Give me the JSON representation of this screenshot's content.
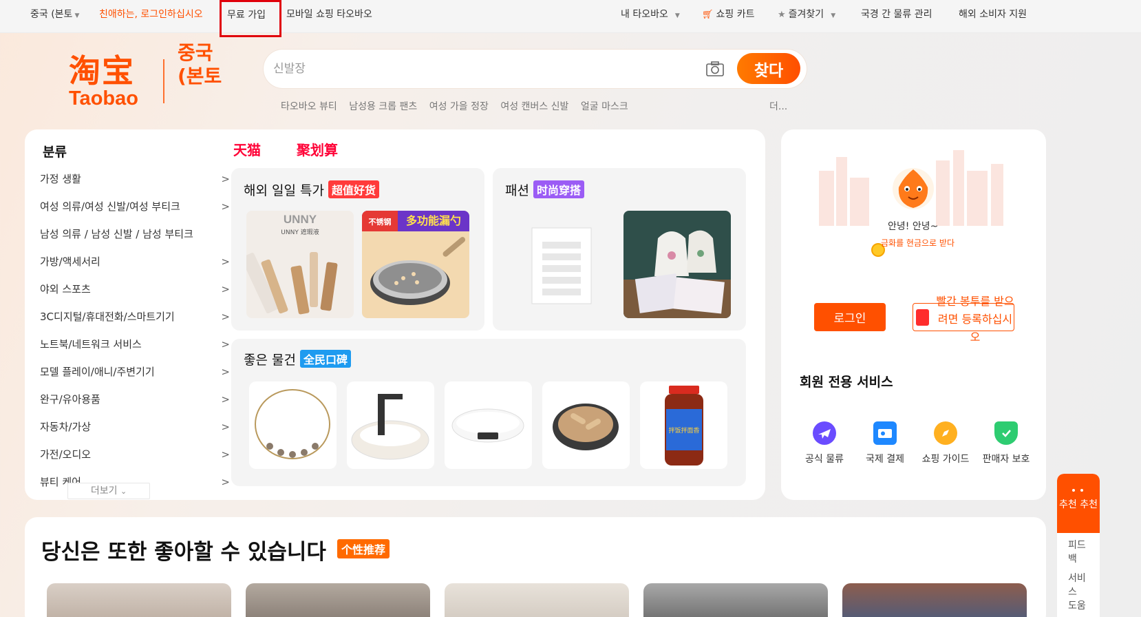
{
  "topbar": {
    "region": "중국 (본토",
    "login_prompt": "친애하는, 로그인하십시오",
    "signup": "무료 가입",
    "mobile": "모바일 쇼핑 타오바오",
    "my_taobao": "내 타오바오",
    "cart": "쇼핑 카트",
    "favorites": "즐겨찾기",
    "logistics": "국경 간 물류 관리",
    "support": "해외 소비자 지원"
  },
  "logo": {
    "cn": "淘宝",
    "en": "Taobao"
  },
  "region_label": "중국 (본토",
  "search": {
    "placeholder": "신발장",
    "button": "찾다"
  },
  "hotwords": [
    "타오바오 뷰티",
    "남성용 크롭 팬츠",
    "여성 가을 정장",
    "여성 캔버스 신발",
    "얼굴 마스크"
  ],
  "hotwords_more": "더...",
  "categories": {
    "title": "분류",
    "items": [
      "가정 생활",
      "여성 의류/여성 신발/여성 부티크",
      "남성 의류 / 남성 신발 / 남성 부티크",
      "가방/액세서리",
      "야외 스포츠",
      "3C디지털/휴대전화/스마트기기",
      "노트북/네트워크 서비스",
      "모델 플레이/애니/주변기기",
      "완구/유아용품",
      "자동차/가상",
      "가전/오디오",
      "뷰티 케어"
    ],
    "more": "더보기"
  },
  "brands": {
    "tmall": "天猫",
    "juhuasuan": "聚划算"
  },
  "panels": {
    "deals": {
      "title": "해외 일일 특가",
      "tag": "超值好货",
      "tag_color": "#ff3b3b"
    },
    "fashion": {
      "title": "패션",
      "tag": "时尚穿搭",
      "tag_color": "#9b5cf5"
    },
    "goods": {
      "title": "좋은 물건",
      "tag": "全民口碑",
      "tag_color": "#1e9bf0"
    }
  },
  "product_text": {
    "unny_brand": "UNNY",
    "unny_sub": "UNNY 遮瑕液",
    "pan_badge": "不锈钢",
    "pan_title": "多功能漏勺",
    "jar_label": "拌饭拌面香"
  },
  "user": {
    "hello": "안녕! 안녕~",
    "coins": "금화를 현금으로 받다",
    "login": "로그인",
    "red_packet": "빨간 봉투를 받으려면 등록하십시오",
    "member_title": "회원 전용 서비스",
    "services": [
      {
        "label": "공식 물류",
        "icon": "airplane-icon",
        "color": "#6a4cff"
      },
      {
        "label": "국제 결제",
        "icon": "wallet-icon",
        "color": "#1e88ff"
      },
      {
        "label": "쇼핑 가이드",
        "icon": "compass-icon",
        "color": "#ffb020"
      },
      {
        "label": "판매자 보호",
        "icon": "shield-icon",
        "color": "#2ecc71"
      }
    ]
  },
  "bottom": {
    "title": "당신은 또한 좋아할 수 있습니다",
    "tag": "个性推荐"
  },
  "sticky": {
    "recommend": "추천 추천",
    "feedback": "피드백",
    "service": "서비스 도움"
  },
  "colors": {
    "accent": "#ff5000",
    "tmall": "#ff0036"
  }
}
